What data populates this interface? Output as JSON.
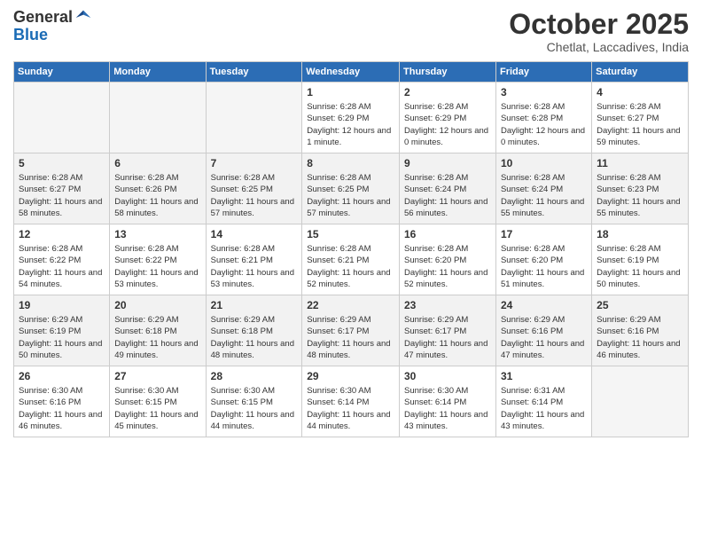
{
  "header": {
    "logo_line1": "General",
    "logo_line2": "Blue",
    "month_title": "October 2025",
    "subtitle": "Chetlat, Laccadives, India"
  },
  "days_of_week": [
    "Sunday",
    "Monday",
    "Tuesday",
    "Wednesday",
    "Thursday",
    "Friday",
    "Saturday"
  ],
  "weeks": [
    [
      {
        "day": "",
        "sunrise": "",
        "sunset": "",
        "daylight": ""
      },
      {
        "day": "",
        "sunrise": "",
        "sunset": "",
        "daylight": ""
      },
      {
        "day": "",
        "sunrise": "",
        "sunset": "",
        "daylight": ""
      },
      {
        "day": "1",
        "sunrise": "Sunrise: 6:28 AM",
        "sunset": "Sunset: 6:29 PM",
        "daylight": "Daylight: 12 hours and 1 minute."
      },
      {
        "day": "2",
        "sunrise": "Sunrise: 6:28 AM",
        "sunset": "Sunset: 6:29 PM",
        "daylight": "Daylight: 12 hours and 0 minutes."
      },
      {
        "day": "3",
        "sunrise": "Sunrise: 6:28 AM",
        "sunset": "Sunset: 6:28 PM",
        "daylight": "Daylight: 12 hours and 0 minutes."
      },
      {
        "day": "4",
        "sunrise": "Sunrise: 6:28 AM",
        "sunset": "Sunset: 6:27 PM",
        "daylight": "Daylight: 11 hours and 59 minutes."
      }
    ],
    [
      {
        "day": "5",
        "sunrise": "Sunrise: 6:28 AM",
        "sunset": "Sunset: 6:27 PM",
        "daylight": "Daylight: 11 hours and 58 minutes."
      },
      {
        "day": "6",
        "sunrise": "Sunrise: 6:28 AM",
        "sunset": "Sunset: 6:26 PM",
        "daylight": "Daylight: 11 hours and 58 minutes."
      },
      {
        "day": "7",
        "sunrise": "Sunrise: 6:28 AM",
        "sunset": "Sunset: 6:25 PM",
        "daylight": "Daylight: 11 hours and 57 minutes."
      },
      {
        "day": "8",
        "sunrise": "Sunrise: 6:28 AM",
        "sunset": "Sunset: 6:25 PM",
        "daylight": "Daylight: 11 hours and 57 minutes."
      },
      {
        "day": "9",
        "sunrise": "Sunrise: 6:28 AM",
        "sunset": "Sunset: 6:24 PM",
        "daylight": "Daylight: 11 hours and 56 minutes."
      },
      {
        "day": "10",
        "sunrise": "Sunrise: 6:28 AM",
        "sunset": "Sunset: 6:24 PM",
        "daylight": "Daylight: 11 hours and 55 minutes."
      },
      {
        "day": "11",
        "sunrise": "Sunrise: 6:28 AM",
        "sunset": "Sunset: 6:23 PM",
        "daylight": "Daylight: 11 hours and 55 minutes."
      }
    ],
    [
      {
        "day": "12",
        "sunrise": "Sunrise: 6:28 AM",
        "sunset": "Sunset: 6:22 PM",
        "daylight": "Daylight: 11 hours and 54 minutes."
      },
      {
        "day": "13",
        "sunrise": "Sunrise: 6:28 AM",
        "sunset": "Sunset: 6:22 PM",
        "daylight": "Daylight: 11 hours and 53 minutes."
      },
      {
        "day": "14",
        "sunrise": "Sunrise: 6:28 AM",
        "sunset": "Sunset: 6:21 PM",
        "daylight": "Daylight: 11 hours and 53 minutes."
      },
      {
        "day": "15",
        "sunrise": "Sunrise: 6:28 AM",
        "sunset": "Sunset: 6:21 PM",
        "daylight": "Daylight: 11 hours and 52 minutes."
      },
      {
        "day": "16",
        "sunrise": "Sunrise: 6:28 AM",
        "sunset": "Sunset: 6:20 PM",
        "daylight": "Daylight: 11 hours and 52 minutes."
      },
      {
        "day": "17",
        "sunrise": "Sunrise: 6:28 AM",
        "sunset": "Sunset: 6:20 PM",
        "daylight": "Daylight: 11 hours and 51 minutes."
      },
      {
        "day": "18",
        "sunrise": "Sunrise: 6:28 AM",
        "sunset": "Sunset: 6:19 PM",
        "daylight": "Daylight: 11 hours and 50 minutes."
      }
    ],
    [
      {
        "day": "19",
        "sunrise": "Sunrise: 6:29 AM",
        "sunset": "Sunset: 6:19 PM",
        "daylight": "Daylight: 11 hours and 50 minutes."
      },
      {
        "day": "20",
        "sunrise": "Sunrise: 6:29 AM",
        "sunset": "Sunset: 6:18 PM",
        "daylight": "Daylight: 11 hours and 49 minutes."
      },
      {
        "day": "21",
        "sunrise": "Sunrise: 6:29 AM",
        "sunset": "Sunset: 6:18 PM",
        "daylight": "Daylight: 11 hours and 48 minutes."
      },
      {
        "day": "22",
        "sunrise": "Sunrise: 6:29 AM",
        "sunset": "Sunset: 6:17 PM",
        "daylight": "Daylight: 11 hours and 48 minutes."
      },
      {
        "day": "23",
        "sunrise": "Sunrise: 6:29 AM",
        "sunset": "Sunset: 6:17 PM",
        "daylight": "Daylight: 11 hours and 47 minutes."
      },
      {
        "day": "24",
        "sunrise": "Sunrise: 6:29 AM",
        "sunset": "Sunset: 6:16 PM",
        "daylight": "Daylight: 11 hours and 47 minutes."
      },
      {
        "day": "25",
        "sunrise": "Sunrise: 6:29 AM",
        "sunset": "Sunset: 6:16 PM",
        "daylight": "Daylight: 11 hours and 46 minutes."
      }
    ],
    [
      {
        "day": "26",
        "sunrise": "Sunrise: 6:30 AM",
        "sunset": "Sunset: 6:16 PM",
        "daylight": "Daylight: 11 hours and 46 minutes."
      },
      {
        "day": "27",
        "sunrise": "Sunrise: 6:30 AM",
        "sunset": "Sunset: 6:15 PM",
        "daylight": "Daylight: 11 hours and 45 minutes."
      },
      {
        "day": "28",
        "sunrise": "Sunrise: 6:30 AM",
        "sunset": "Sunset: 6:15 PM",
        "daylight": "Daylight: 11 hours and 44 minutes."
      },
      {
        "day": "29",
        "sunrise": "Sunrise: 6:30 AM",
        "sunset": "Sunset: 6:14 PM",
        "daylight": "Daylight: 11 hours and 44 minutes."
      },
      {
        "day": "30",
        "sunrise": "Sunrise: 6:30 AM",
        "sunset": "Sunset: 6:14 PM",
        "daylight": "Daylight: 11 hours and 43 minutes."
      },
      {
        "day": "31",
        "sunrise": "Sunrise: 6:31 AM",
        "sunset": "Sunset: 6:14 PM",
        "daylight": "Daylight: 11 hours and 43 minutes."
      },
      {
        "day": "",
        "sunrise": "",
        "sunset": "",
        "daylight": ""
      }
    ]
  ]
}
